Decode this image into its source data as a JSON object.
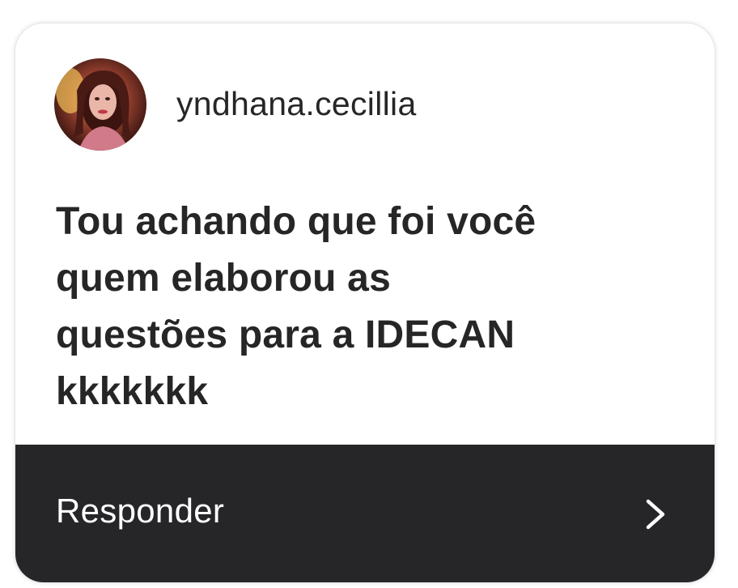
{
  "author": {
    "username": "yndhana.cecillia",
    "avatar_icon": "profile-photo"
  },
  "message": {
    "lines": [
      "Tou achando que foi você",
      "quem elaborou as",
      "questões para a IDECAN",
      "kkkkkkk"
    ]
  },
  "reply": {
    "label": "Responder",
    "icon": "chevron-right-icon"
  },
  "colors": {
    "text": "#262626",
    "bar": "#262629",
    "bar_text": "#ffffff"
  }
}
